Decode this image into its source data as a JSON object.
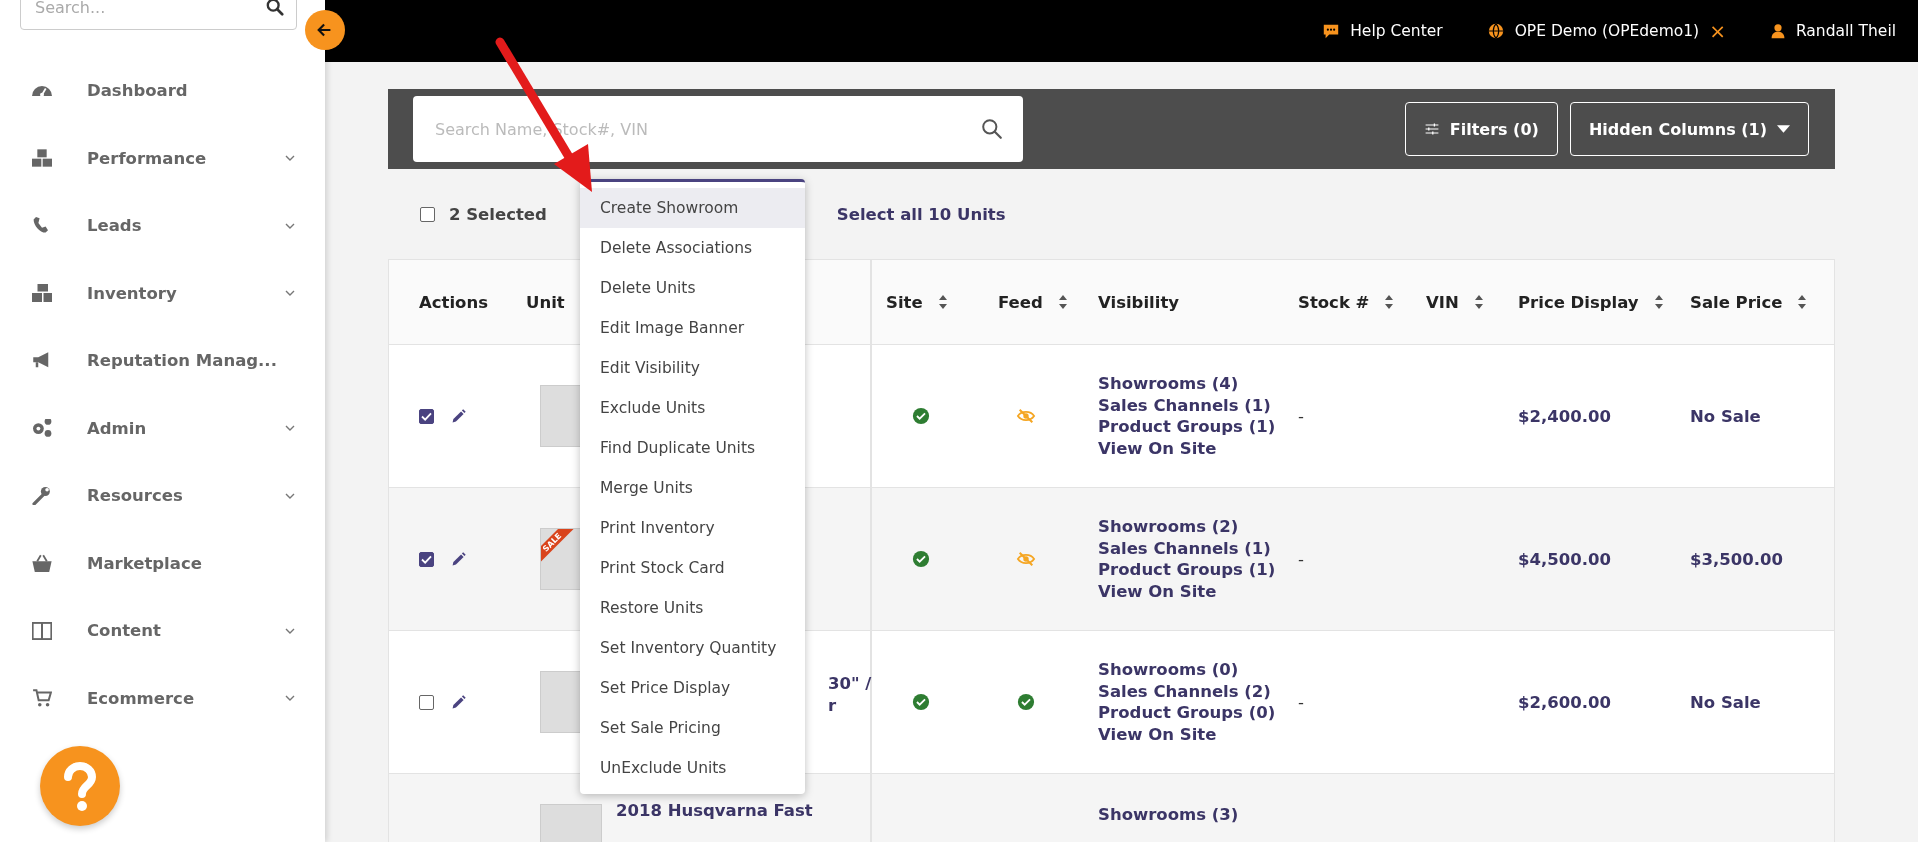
{
  "sidebar": {
    "search": {
      "placeholder": "Search..."
    },
    "items": [
      {
        "label": "Dashboard",
        "has_submenu": false
      },
      {
        "label": "Performance",
        "has_submenu": true
      },
      {
        "label": "Leads",
        "has_submenu": true
      },
      {
        "label": "Inventory",
        "has_submenu": true
      },
      {
        "label": "Reputation Manag...",
        "has_submenu": false
      },
      {
        "label": "Admin",
        "has_submenu": true
      },
      {
        "label": "Resources",
        "has_submenu": true
      },
      {
        "label": "Marketplace",
        "has_submenu": false
      },
      {
        "label": "Content",
        "has_submenu": true
      },
      {
        "label": "Ecommerce",
        "has_submenu": true
      }
    ]
  },
  "topbar": {
    "help": "Help Center",
    "account": "OPE Demo (OPEdemo1)",
    "close": "×",
    "user": "Randall Theil"
  },
  "toolbar": {
    "search": {
      "placeholder": "Search Name, Stock#, VIN"
    },
    "filters": "Filters (0)",
    "hidden_columns": "Hidden Columns (1)"
  },
  "selection": {
    "checked": false,
    "label": "2 Selected",
    "select_all": "Select all 10 Units"
  },
  "menu": [
    {
      "label": "Create Showroom",
      "selected": true
    },
    {
      "label": "Delete Associations",
      "selected": false
    },
    {
      "label": "Delete Units",
      "selected": false
    },
    {
      "label": "Edit Image Banner",
      "selected": false
    },
    {
      "label": "Edit Visibility",
      "selected": false
    },
    {
      "label": "Exclude Units",
      "selected": false
    },
    {
      "label": "Find Duplicate Units",
      "selected": false
    },
    {
      "label": "Merge Units",
      "selected": false
    },
    {
      "label": "Print Inventory",
      "selected": false
    },
    {
      "label": "Print Stock Card",
      "selected": false
    },
    {
      "label": "Restore Units",
      "selected": false
    },
    {
      "label": "Set Inventory Quantity",
      "selected": false
    },
    {
      "label": "Set Price Display",
      "selected": false
    },
    {
      "label": "Set Sale Pricing",
      "selected": false
    },
    {
      "label": "UnExclude Units",
      "selected": false
    }
  ],
  "table": {
    "columns": [
      {
        "label": "Actions",
        "sortable": false
      },
      {
        "label": "Unit",
        "sortable": false
      },
      {
        "label": "Site",
        "sortable": true
      },
      {
        "label": "Feed",
        "sortable": true
      },
      {
        "label": "Visibility",
        "sortable": false
      },
      {
        "label": "Stock #",
        "sortable": true
      },
      {
        "label": "VIN",
        "sortable": true
      },
      {
        "label": "Price Display",
        "sortable": true
      },
      {
        "label": "Sale Price",
        "sortable": true
      }
    ],
    "rows": [
      {
        "checked": true,
        "badge": null,
        "site_live": true,
        "feed_visible": false,
        "visibility": [
          "Showrooms (4)",
          "Sales Channels (1)",
          "Product Groups (1)",
          "View On Site"
        ],
        "stock": "-",
        "price": "$2,400.00",
        "sale": "No Sale"
      },
      {
        "checked": true,
        "badge": "SALE",
        "site_live": true,
        "feed_visible": false,
        "visibility": [
          "Showrooms (2)",
          "Sales Channels (1)",
          "Product Groups (1)",
          "View On Site"
        ],
        "stock": "-",
        "price": "$4,500.00",
        "sale": "$3,500.00"
      },
      {
        "checked": false,
        "badge": null,
        "name": {
          "kind": "covered",
          "lines": [
            "30\" /",
            "r"
          ]
        },
        "site_live": true,
        "feed_visible": true,
        "visibility": [
          "Showrooms (0)",
          "Sales Channels (2)",
          "Product Groups (0)",
          "View On Site"
        ],
        "stock": "-",
        "price": "$2,600.00",
        "sale": "No Sale"
      },
      {
        "badge": null,
        "name": {
          "kind": "full",
          "lines": [
            "2018 Husqvarna Fast"
          ]
        },
        "visibility": [
          "Showrooms (3)"
        ]
      }
    ]
  }
}
